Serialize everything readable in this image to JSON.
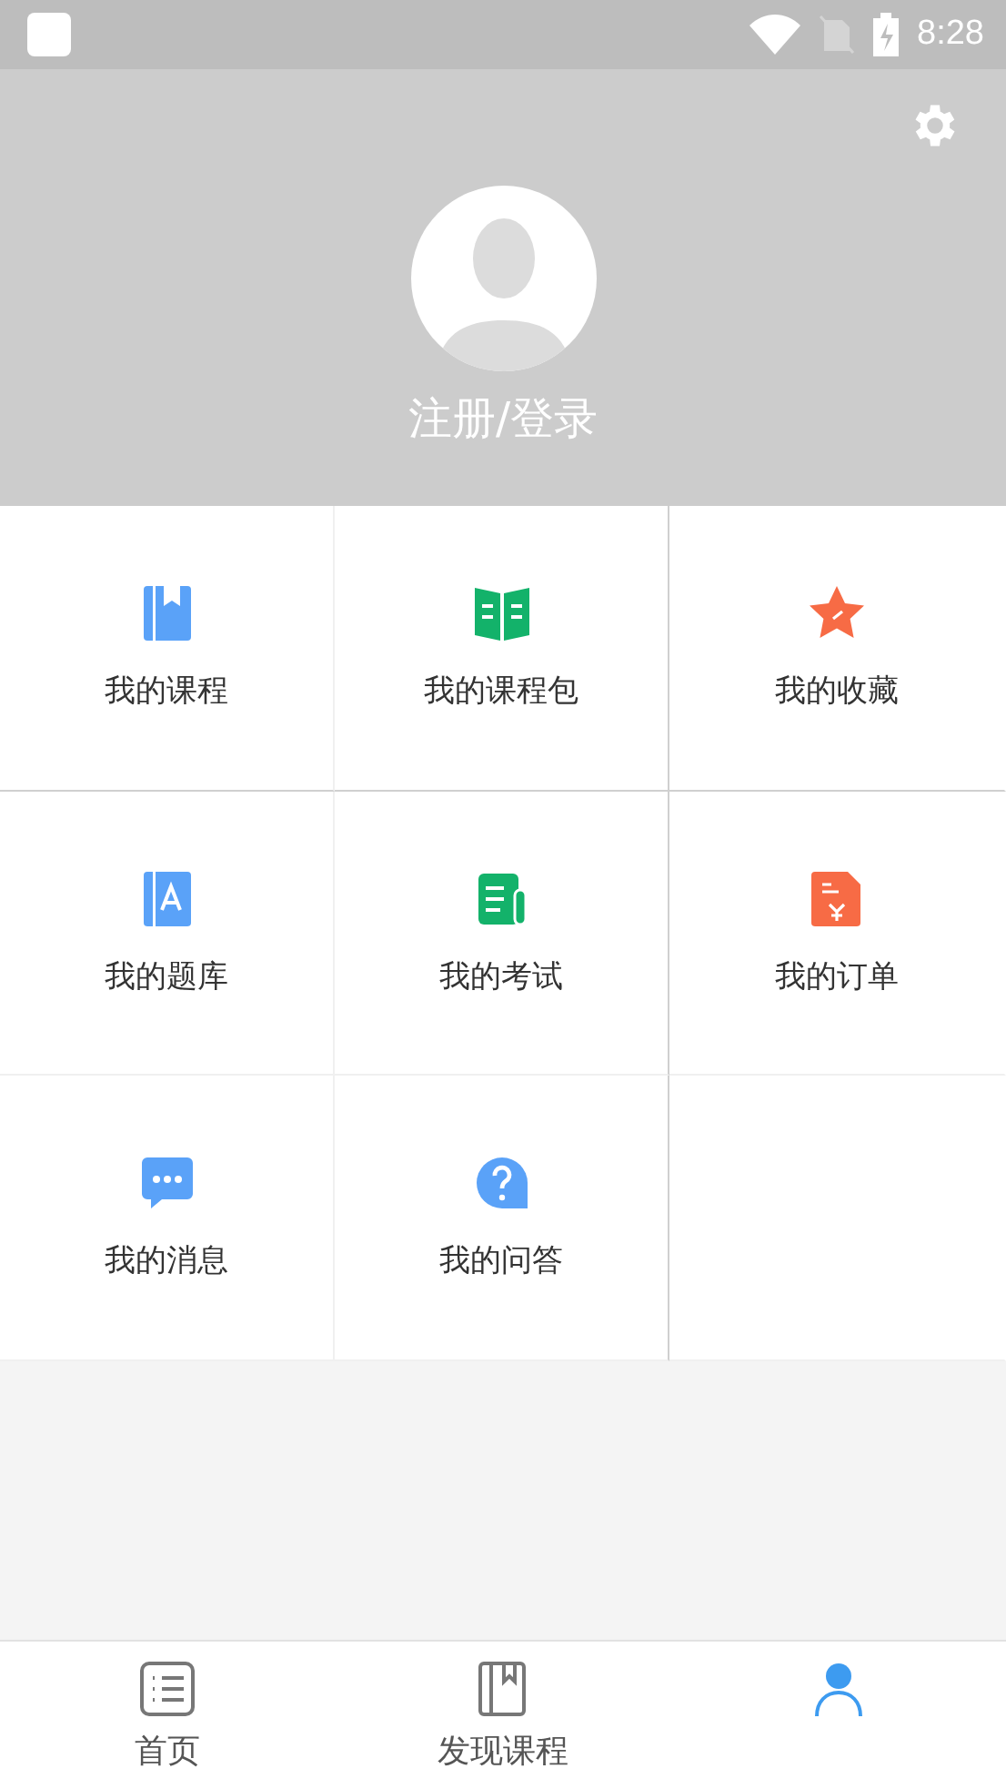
{
  "status_bar": {
    "time": "8:28"
  },
  "profile": {
    "login_label": "注册/登录"
  },
  "menu": [
    {
      "label": "我的课程",
      "kind": "course"
    },
    {
      "label": "我的课程包",
      "kind": "package"
    },
    {
      "label": "我的收藏",
      "kind": "favorite"
    },
    {
      "label": "我的题库",
      "kind": "bank"
    },
    {
      "label": "我的考试",
      "kind": "exam"
    },
    {
      "label": "我的订单",
      "kind": "order"
    },
    {
      "label": "我的消息",
      "kind": "message"
    },
    {
      "label": "我的问答",
      "kind": "qa"
    }
  ],
  "tabs": [
    {
      "label": "首页",
      "kind": "home",
      "selected": false
    },
    {
      "label": "发现课程",
      "kind": "discover",
      "selected": false
    },
    {
      "kind": "me",
      "selected": true
    }
  ]
}
